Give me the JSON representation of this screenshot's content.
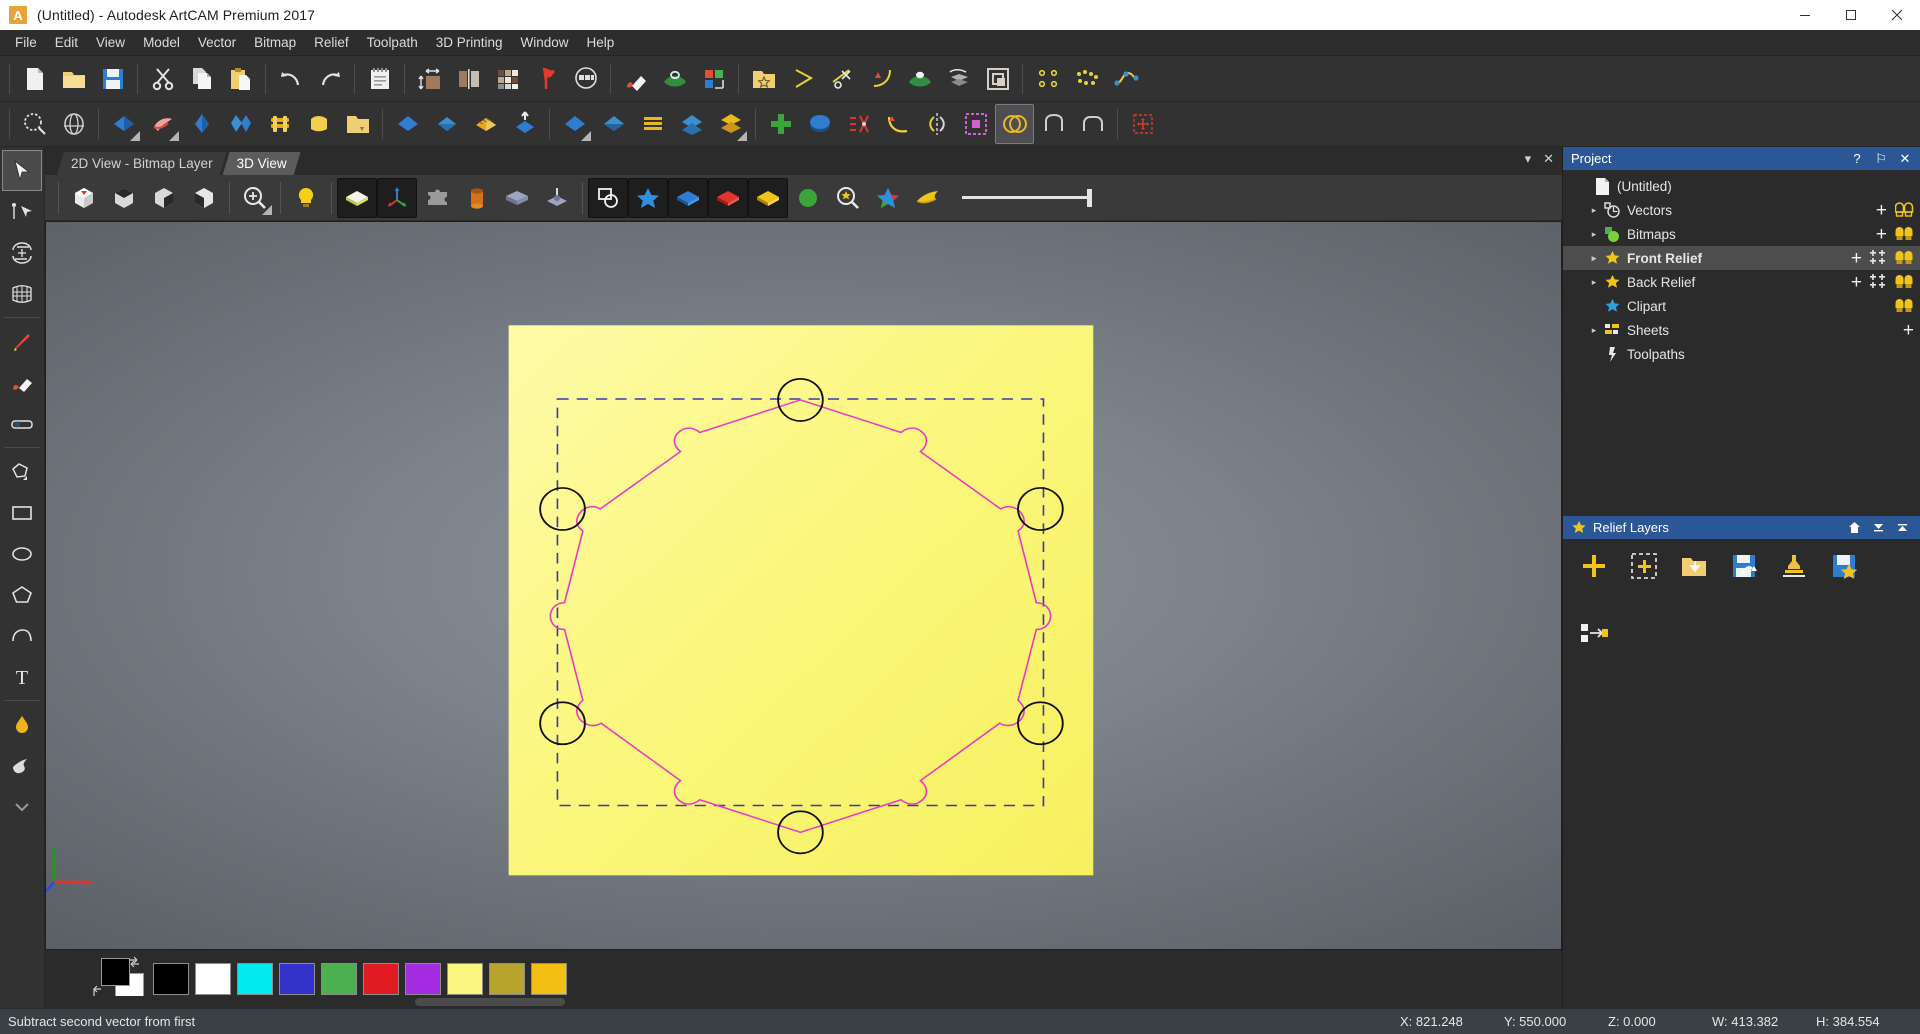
{
  "window": {
    "title": "(Untitled) - Autodesk ArtCAM Premium 2017",
    "app_icon_letter": "A",
    "minimize": "—",
    "maximize": "❐",
    "close": "✕"
  },
  "menubar": {
    "items": [
      {
        "label": "File"
      },
      {
        "label": "Edit"
      },
      {
        "label": "View"
      },
      {
        "label": "Model"
      },
      {
        "label": "Vector"
      },
      {
        "label": "Bitmap"
      },
      {
        "label": "Relief"
      },
      {
        "label": "Toolpath"
      },
      {
        "label": "3D Printing"
      },
      {
        "label": "Window"
      },
      {
        "label": "Help"
      }
    ]
  },
  "toolbar_row1": {
    "buttons": [
      {
        "name": "new-model-icon",
        "tip": "New Model"
      },
      {
        "name": "open-model-icon",
        "tip": "Open Model"
      },
      {
        "name": "save-model-icon",
        "tip": "Save Model"
      },
      {
        "name": "cut-icon",
        "tip": "Cut"
      },
      {
        "name": "copy-icon",
        "tip": "Copy"
      },
      {
        "name": "paste-icon",
        "tip": "Paste"
      },
      {
        "name": "undo-icon",
        "tip": "Undo"
      },
      {
        "name": "redo-icon",
        "tip": "Redo"
      },
      {
        "name": "notes-icon",
        "tip": "Model Notes"
      },
      {
        "name": "set-size-icon",
        "tip": "Set Model Size"
      },
      {
        "name": "model-thickness-icon",
        "tip": "Model Thickness"
      },
      {
        "name": "tiles-icon",
        "tip": "Model Tiles"
      },
      {
        "name": "lighting-flag-icon",
        "tip": "Lighting"
      },
      {
        "name": "shading-mode-icon",
        "tip": "Shading"
      },
      {
        "name": "material-diamond-icon",
        "tip": "Material"
      },
      {
        "name": "visibility-eye-icon",
        "tip": "Visibility"
      },
      {
        "name": "color-grid-icon",
        "tip": "Colour Settings"
      },
      {
        "name": "clipart-folder-icon",
        "tip": "Clipart Library"
      },
      {
        "name": "vector-arrow-icon",
        "tip": "Vector Tool"
      },
      {
        "name": "vector-trim-icon",
        "tip": "Trim Vectors"
      },
      {
        "name": "vector-curve-icon",
        "tip": "Curve Fit"
      },
      {
        "name": "preview-eye-icon",
        "tip": "Preview"
      },
      {
        "name": "simulation-icon",
        "tip": "Simulate Toolpath"
      },
      {
        "name": "layers-stack-icon",
        "tip": "Layer Manager"
      },
      {
        "name": "nodes-small-icon",
        "tip": "Node Editing"
      },
      {
        "name": "nodes-dense-icon",
        "tip": "Points"
      },
      {
        "name": "spline-nodes-icon",
        "tip": "Spline"
      }
    ]
  },
  "toolbar_row2": {
    "buttons": [
      {
        "name": "zoom-model-icon",
        "tip": "Zoom Model"
      },
      {
        "name": "wireframe-icon",
        "tip": "Wireframe View"
      },
      {
        "name": "relief-blue-icon",
        "tip": "Create Relief"
      },
      {
        "name": "relief-pink-icon",
        "tip": "Smooth Relief"
      },
      {
        "name": "extrude-blue-icon",
        "tip": "Extrude"
      },
      {
        "name": "spin-blue-icon",
        "tip": "Spin"
      },
      {
        "name": "weave-gold-icon",
        "tip": "Weave"
      },
      {
        "name": "texture-gold-icon",
        "tip": "Texture"
      },
      {
        "name": "relief-clipart-icon",
        "tip": "Relief Clipart"
      },
      {
        "name": "vector-blue-icon",
        "tip": "Vector Relief"
      },
      {
        "name": "two-rail-sweep-icon",
        "tip": "Two Rail Sweep"
      },
      {
        "name": "layer-stripe-icon",
        "tip": "Layers"
      },
      {
        "name": "turn-relief-icon",
        "tip": "Turn Relief"
      },
      {
        "name": "sculpt-icon",
        "tip": "Sculpt"
      },
      {
        "name": "shape-editor-icon",
        "tip": "Shape Editor"
      },
      {
        "name": "blue-plane-icon",
        "tip": "Plane"
      },
      {
        "name": "stack-layers-icon",
        "tip": "Stacked Layers"
      },
      {
        "name": "add-green-icon",
        "tip": "Add"
      },
      {
        "name": "merge-blue-icon",
        "tip": "Merge"
      },
      {
        "name": "subtract-red-icon",
        "tip": "Subtract"
      },
      {
        "name": "curve-yellow-icon",
        "tip": "Curve"
      },
      {
        "name": "mirror-icon",
        "tip": "Mirror"
      },
      {
        "name": "select-area-icon",
        "tip": "Select Area"
      },
      {
        "name": "subtract-vector-icon",
        "tip": "Subtract second vector from first",
        "selected": true
      },
      {
        "name": "weld-shape-icon",
        "tip": "Weld Vectors"
      },
      {
        "name": "round-shape-icon",
        "tip": "Round Corner"
      },
      {
        "name": "transform-icon",
        "tip": "Transform"
      }
    ]
  },
  "tabs": {
    "items": [
      {
        "label": "2D View - Bitmap Layer",
        "active": false
      },
      {
        "label": "3D View",
        "active": true
      }
    ],
    "minimize": "▾",
    "close": "✕"
  },
  "view3d_toolbar": {
    "buttons": [
      {
        "name": "iso-view-icon",
        "tip": "Isometric View"
      },
      {
        "name": "front-view-icon",
        "tip": "Front View"
      },
      {
        "name": "side-view-icon",
        "tip": "Side View"
      },
      {
        "name": "top-view-icon",
        "tip": "Plan View"
      },
      {
        "name": "zoom-in-icon",
        "tip": "Zoom"
      },
      {
        "name": "light-bulb-icon",
        "tip": "Lighting"
      },
      {
        "name": "material-block-icon",
        "tip": "Material"
      },
      {
        "name": "axis-gizmo-icon",
        "tip": "Show Axes"
      },
      {
        "name": "puzzle-icon",
        "tip": "Model Components"
      },
      {
        "name": "cylinder-icon",
        "tip": "Rotary Blank"
      },
      {
        "name": "slab-icon",
        "tip": "Block"
      },
      {
        "name": "machine-icon",
        "tip": "Machining"
      },
      {
        "name": "toggle-relief-icon",
        "tip": "Toggle Relief"
      },
      {
        "name": "star-blue-icon",
        "tip": "Clipart"
      },
      {
        "name": "layer-blue-icon",
        "tip": "Layer"
      },
      {
        "name": "layer-red-icon",
        "tip": "Composite Relief"
      },
      {
        "name": "layer-yellow-icon",
        "tip": "Front Relief",
        "selected": true
      },
      {
        "name": "green-circle-icon",
        "tip": "Show Green"
      },
      {
        "name": "zoom-star-icon",
        "tip": "Zoom to Fit"
      },
      {
        "name": "multi-color-icon",
        "tip": "Colour Shade"
      },
      {
        "name": "ribbon-icon",
        "tip": "Ribbon"
      }
    ],
    "slider_name": "relief-transparency-slider"
  },
  "left_tools": {
    "buttons": [
      {
        "name": "select-arrow-tool",
        "tip": "Select Vectors",
        "selected": true
      },
      {
        "name": "node-edit-tool",
        "tip": "Node Editing"
      },
      {
        "name": "transform-tool",
        "tip": "Transform Vectors"
      },
      {
        "name": "distort-tool",
        "tip": "Distort Vectors"
      },
      {
        "name": "polyline-pencil-tool",
        "tip": "Create Polyline"
      },
      {
        "name": "fill-vector-tool",
        "tip": "Fill Vector"
      },
      {
        "name": "measure-tool",
        "tip": "Measure"
      },
      {
        "name": "freehand-tool",
        "tip": "Create Freehand"
      },
      {
        "name": "rectangle-tool",
        "tip": "Create Rectangle"
      },
      {
        "name": "ellipse-tool",
        "tip": "Create Ellipse"
      },
      {
        "name": "polygon-tool",
        "tip": "Create Polygon"
      },
      {
        "name": "arc-tool",
        "tip": "Create Arc"
      },
      {
        "name": "text-tool",
        "tip": "Create Vector Text"
      },
      {
        "name": "paint-flood-tool",
        "tip": "Flood Fill"
      },
      {
        "name": "smudge-tool",
        "tip": "Smudge"
      },
      {
        "name": "more-tools-chevron",
        "tip": "More Tools"
      }
    ]
  },
  "viewport": {
    "name": "3d-viewport",
    "material_color": "#faf57c",
    "vector_color": "#e83ac8",
    "bbox_color": "#3a3aa8",
    "axis_origin_label": ""
  },
  "palette": {
    "foreground": "#000000",
    "background": "#ffffff",
    "swatches": [
      {
        "name": "swatch-black",
        "color": "#000000"
      },
      {
        "name": "swatch-white",
        "color": "#ffffff"
      },
      {
        "name": "swatch-cyan",
        "color": "#00eaf0"
      },
      {
        "name": "swatch-blue",
        "color": "#3333cc"
      },
      {
        "name": "swatch-green",
        "color": "#4caf50"
      },
      {
        "name": "swatch-red",
        "color": "#e01b24"
      },
      {
        "name": "swatch-purple",
        "color": "#a32ce0"
      },
      {
        "name": "swatch-lightyellow",
        "color": "#f9f57e"
      },
      {
        "name": "swatch-olive",
        "color": "#b8a32c"
      },
      {
        "name": "swatch-gold",
        "color": "#f2bf13"
      }
    ]
  },
  "project_panel": {
    "title": "Project",
    "help": "?",
    "pin": "⚐",
    "close": "✕",
    "items": [
      {
        "label": "(Untitled)",
        "icon": "document-icon",
        "indent": 0,
        "expandable": false,
        "selected": false,
        "actions": []
      },
      {
        "label": "Vectors",
        "icon": "vectors-icon",
        "indent": 1,
        "expandable": true,
        "selected": false,
        "actions": [
          "plus",
          "bulb"
        ]
      },
      {
        "label": "Bitmaps",
        "icon": "bitmaps-icon",
        "indent": 1,
        "expandable": true,
        "selected": false,
        "actions": [
          "plus",
          "bulb"
        ]
      },
      {
        "label": "Front Relief",
        "icon": "star-gold-icon",
        "indent": 1,
        "expandable": true,
        "selected": true,
        "actions": [
          "plus",
          "grid",
          "bulb"
        ]
      },
      {
        "label": "Back Relief",
        "icon": "star-gold-icon",
        "indent": 1,
        "expandable": true,
        "selected": false,
        "actions": [
          "plus",
          "grid",
          "bulb"
        ]
      },
      {
        "label": "Clipart",
        "icon": "star-blue-icon",
        "indent": 1,
        "expandable": false,
        "selected": false,
        "actions": [
          "bulb"
        ]
      },
      {
        "label": "Sheets",
        "icon": "sheets-icon",
        "indent": 1,
        "expandable": true,
        "selected": false,
        "actions": [
          "plus"
        ]
      },
      {
        "label": "Toolpaths",
        "icon": "toolpaths-icon",
        "indent": 1,
        "expandable": false,
        "selected": false,
        "actions": []
      }
    ]
  },
  "relief_layers_panel": {
    "title": "Relief Layers",
    "header_icons": [
      "home-icon",
      "collapse-down-icon",
      "collapse-up-icon"
    ],
    "tools": [
      {
        "name": "add-layer-icon",
        "tip": "Add New Relief Layer"
      },
      {
        "name": "add-layer-dashed-icon",
        "tip": "Add Layer From Selection"
      },
      {
        "name": "import-layer-icon",
        "tip": "Import Relief Layer"
      },
      {
        "name": "save-layer-icon",
        "tip": "Save Relief Layer"
      },
      {
        "name": "stamp-layer-icon",
        "tip": "Stamp Layer"
      },
      {
        "name": "save-as-clipart-icon",
        "tip": "Save As Clipart"
      },
      {
        "name": "move-to-layer-icon",
        "tip": "Move To Layer"
      }
    ]
  },
  "statusbar": {
    "message": "Subtract second vector from first",
    "coords": [
      {
        "name": "status-x",
        "label": "X: 821.248"
      },
      {
        "name": "status-y",
        "label": "Y: 550.000"
      },
      {
        "name": "status-z",
        "label": "Z: 0.000"
      },
      {
        "name": "status-w",
        "label": "W: 413.382"
      },
      {
        "name": "status-h",
        "label": "H: 384.554"
      }
    ]
  },
  "colors": {
    "titlebar_bg": "#ffffff",
    "chrome_bg": "#2b2b2b",
    "toolbar_bg": "#323232",
    "panel_header": "#2b5797",
    "status_bg": "#3a4043",
    "accent_gold": "#f2c12e"
  }
}
